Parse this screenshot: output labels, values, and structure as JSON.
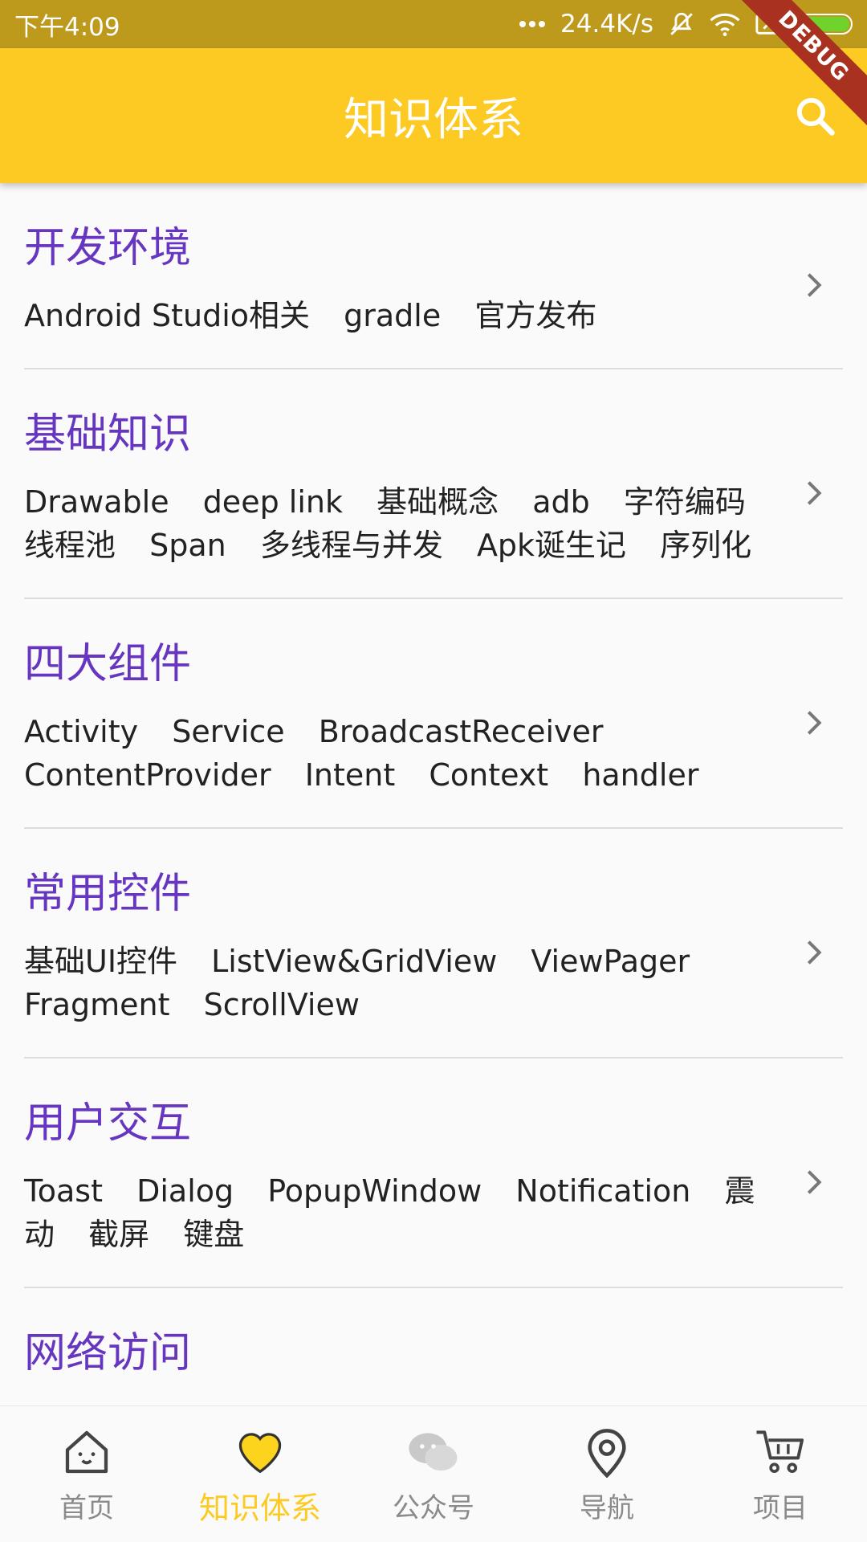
{
  "status_bar": {
    "time": "下午4:09",
    "network_speed": "24.4K/s",
    "icons": [
      "signal-dots-icon",
      "mute-icon",
      "wifi-icon",
      "sim-icon",
      "battery-icon"
    ]
  },
  "app_bar": {
    "title": "知识体系",
    "search_icon": "search-icon",
    "debug_label": "DEBUG"
  },
  "colors": {
    "accent": "#fcca23",
    "category_title": "#6736c0",
    "status_bar": "#bd9a1c"
  },
  "categories": [
    {
      "title": "开发环境",
      "tags": [
        "Android Studio相关",
        "gradle",
        "官方发布"
      ]
    },
    {
      "title": "基础知识",
      "tags": [
        "Drawable",
        "deep link",
        "基础概念",
        "adb",
        "字符编码",
        "线程池",
        "Span",
        "多线程与并发",
        "Apk诞生记",
        "序列化"
      ]
    },
    {
      "title": "四大组件",
      "tags": [
        "Activity",
        "Service",
        "BroadcastReceiver",
        "ContentProvider",
        "Intent",
        "Context",
        "handler"
      ]
    },
    {
      "title": "常用控件",
      "tags": [
        "基础UI控件",
        "ListView&GridView",
        "ViewPager",
        "Fragment",
        "ScrollView"
      ]
    },
    {
      "title": "用户交互",
      "tags": [
        "Toast",
        "Dialog",
        "PopupWindow",
        "Notification",
        "震动",
        "截屏",
        "键盘"
      ]
    },
    {
      "title": "网络访问",
      "tags": []
    }
  ],
  "bottom_nav": {
    "items": [
      {
        "label": "首页",
        "icon": "home-icon",
        "active": false
      },
      {
        "label": "知识体系",
        "icon": "heart-icon",
        "active": true
      },
      {
        "label": "公众号",
        "icon": "wechat-icon",
        "active": false
      },
      {
        "label": "导航",
        "icon": "location-pin-icon",
        "active": false
      },
      {
        "label": "项目",
        "icon": "cart-icon",
        "active": false
      }
    ]
  }
}
